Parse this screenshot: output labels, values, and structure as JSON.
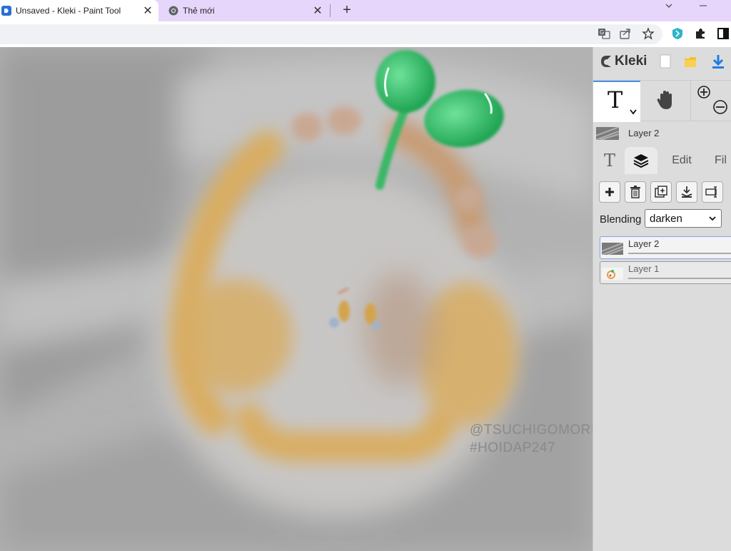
{
  "browser": {
    "tabs": [
      {
        "title": "Unsaved - Kleki - Paint Tool",
        "active": true,
        "icon": "kleki-favicon"
      },
      {
        "title": "Thẻ mới",
        "active": false,
        "icon": "chrome-icon"
      }
    ],
    "close_glyph": "✕",
    "new_tab_glyph": "+",
    "toolbar_icons": [
      "translate-icon",
      "share-icon",
      "star-icon",
      "extension-shield-icon",
      "puzzle-icon",
      "sidepanel-icon"
    ]
  },
  "watermark": {
    "line1": "@TSUCHIGOMORI",
    "line2": "#HOIDAP247"
  },
  "sidebar": {
    "logo": "Kleki",
    "tools": [
      {
        "name": "text-tool",
        "label": "T",
        "selected": true
      },
      {
        "name": "hand-tool",
        "selected": false
      },
      {
        "name": "zoom-tool",
        "selected": false
      }
    ],
    "current_layer_name": "Layer 2",
    "tabs": [
      {
        "label": "T",
        "selected": false
      },
      {
        "label": "layers",
        "selected": true
      },
      {
        "label": "Edit",
        "selected": false
      },
      {
        "label": "Fil",
        "selected": false
      }
    ],
    "layer_actions": [
      "add-layer",
      "delete-layer",
      "duplicate-layer",
      "merge-layer",
      "rename-layer"
    ],
    "blending": {
      "label": "Blending",
      "value": "darken"
    },
    "layers": [
      {
        "name": "Layer 2",
        "active": true
      },
      {
        "name": "Layer 1",
        "active": false
      }
    ]
  },
  "colors": {
    "tabstrip": "#e6d6fb",
    "canvas_gray": "#a9a9a9",
    "sprout_green": "#3dbf6a",
    "ring_yellow": "#e2b45c",
    "accent_blue": "#4a90e2"
  }
}
